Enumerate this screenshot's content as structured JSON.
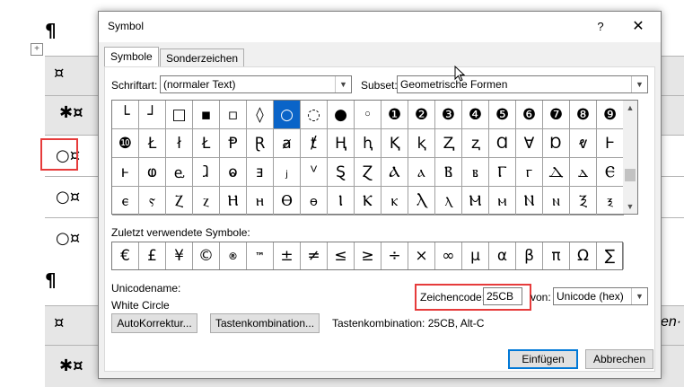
{
  "document": {
    "pilcrow": "¶",
    "cells": [
      "¤",
      "✱¤",
      "○¤",
      "○¤",
      "○¤",
      "¤",
      "✱¤"
    ],
    "right_text": "en·",
    "move_handle": "+"
  },
  "dialog": {
    "title": "Symbol",
    "help_label": "?",
    "close_label": "✕",
    "tabs": [
      {
        "label": "Symbole",
        "active": true
      },
      {
        "label": "Sonderzeichen",
        "active": false
      }
    ],
    "font_label": "Schriftart:",
    "font_value": "(normaler Text)",
    "subset_label": "Subset:",
    "subset_value": "Geometrische Formen",
    "symbols": [
      "└",
      "┘",
      "□",
      "▪",
      "▫",
      "◊",
      "○",
      "◌",
      "●",
      "◦",
      "❶",
      "❷",
      "❸",
      "❹",
      "❺",
      "❻",
      "❼",
      "❽",
      "❾",
      "❿",
      "Ł",
      "ł",
      "Ł",
      "Ᵽ",
      "Ɽ",
      "ⱥ",
      "ⱦ",
      "Ⱨ",
      "ⱨ",
      "Ⱪ",
      "ⱪ",
      "Ⱬ",
      "ⱬ",
      "Ɑ",
      "Ɐ",
      "Ɒ",
      "ⱴ",
      "Ⱶ",
      "ⱶ",
      "ⱷ",
      "ⱸ",
      "ⱹ",
      "ⱺ",
      "ⱻ",
      "ⱼ",
      "ⱽ",
      "Ȿ",
      "Ɀ",
      "Ⲁ",
      "ⲁ",
      "Ⲃ",
      "ⲃ",
      "Ⲅ",
      "ⲅ",
      "Ⲇ",
      "ⲇ",
      "Ⲉ",
      "ⲉ",
      "ⲋ",
      "Ⲍ",
      "ⲍ",
      "Ⲏ",
      "ⲏ",
      "Ⲑ",
      "ⲑ",
      "Ⲓ",
      "Ⲕ",
      "ⲕ",
      "Ⲗ",
      "ⲗ",
      "Ⲙ",
      "ⲙ",
      "Ⲛ",
      "ⲛ",
      "Ⲝ",
      "ⲝ"
    ],
    "selected_index": 6,
    "recent_label": "Zuletzt verwendete Symbole:",
    "recent": [
      "€",
      "£",
      "¥",
      "©",
      "®",
      "™",
      "±",
      "≠",
      "≤",
      "≥",
      "÷",
      "×",
      "∞",
      "µ",
      "α",
      "β",
      "π",
      "Ω",
      "∑"
    ],
    "unicode_name_label": "Unicodename:",
    "unicode_name_value": "White Circle",
    "code_label": "Zeichencode:",
    "code_value": "25CB",
    "from_label": "von:",
    "from_value": "Unicode (hex)",
    "autocorrect_button": "AutoKorrektur...",
    "shortcut_button": "Tastenkombination...",
    "shortcut_text": "Tastenkombination: 25CB, Alt-C",
    "insert_button": "Einfügen",
    "cancel_button": "Abbrechen"
  },
  "colors": {
    "selection": "#0a64c8",
    "highlight_box": "#e63b3b",
    "primary_border": "#0078d7"
  }
}
